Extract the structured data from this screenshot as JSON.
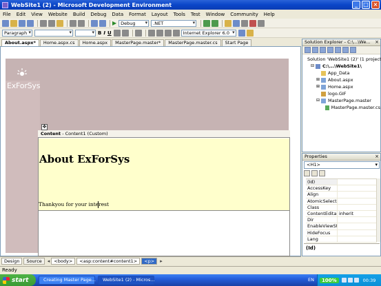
{
  "window": {
    "title": "WebSite1 (2) - Microsoft Development Environment"
  },
  "menu": [
    "File",
    "Edit",
    "View",
    "Website",
    "Build",
    "Debug",
    "Data",
    "Format",
    "Layout",
    "Tools",
    "Test",
    "Window",
    "Community",
    "Help"
  ],
  "toolbar1": {
    "config": "Debug",
    "platform": ".NET"
  },
  "toolbar2": {
    "block_format": "Paragraph",
    "browser_target": "Internet Explorer 6.0"
  },
  "doc_tabs": [
    {
      "label": "About.aspx*",
      "active": true
    },
    {
      "label": "Home.aspx.cs",
      "active": false
    },
    {
      "label": "Home.aspx",
      "active": false
    },
    {
      "label": "MasterPage.master*",
      "active": false
    },
    {
      "label": "MasterPage.master.cs",
      "active": false
    },
    {
      "label": "Start Page",
      "active": false
    }
  ],
  "designer": {
    "logo_text": "ExForSys",
    "content_label_bold": "Content",
    "content_label_rest": " - Content1 (Custom)",
    "heading": "About ExForSys",
    "body_text": "Thankyou for your interest"
  },
  "viewbar": {
    "design_label": "Design",
    "source_label": "Source",
    "tags": [
      "<body>",
      "<asp:content#content1>",
      "<p>"
    ]
  },
  "solution_explorer": {
    "title": "Solution Explorer - C:\\...\\We...",
    "items": [
      {
        "label": "Solution 'WebSite1 (2)' (1 project)",
        "indent": 0,
        "toggle": "",
        "icon_color": "#8a73c9"
      },
      {
        "label": "C:\\...\\WebSite1\\",
        "indent": 1,
        "toggle": "⊟",
        "icon_color": "#6d8cc9",
        "bold": true
      },
      {
        "label": "App_Data",
        "indent": 2,
        "toggle": "",
        "icon_color": "#e6c35a"
      },
      {
        "label": "About.aspx",
        "indent": 2,
        "toggle": "⊞",
        "icon_color": "#7fa4d8"
      },
      {
        "label": "Home.aspx",
        "indent": 2,
        "toggle": "⊞",
        "icon_color": "#7fa4d8"
      },
      {
        "label": "logo.GIF",
        "indent": 2,
        "toggle": "",
        "icon_color": "#d0a040"
      },
      {
        "label": "MasterPage.master",
        "indent": 2,
        "toggle": "⊟",
        "icon_color": "#7fa4d8"
      },
      {
        "label": "MasterPage.master.cs",
        "indent": 3,
        "toggle": "",
        "icon_color": "#5aaa5a"
      }
    ]
  },
  "properties": {
    "title": "Properties",
    "selected": "<H1>",
    "rows": [
      {
        "name": "(Id)",
        "value": ""
      },
      {
        "name": "AccessKey",
        "value": ""
      },
      {
        "name": "Align",
        "value": ""
      },
      {
        "name": "AtomicSelection",
        "value": ""
      },
      {
        "name": "Class",
        "value": ""
      },
      {
        "name": "ContentEditable",
        "value": "inherit"
      },
      {
        "name": "Dir",
        "value": ""
      },
      {
        "name": "EnableViewState",
        "value": ""
      },
      {
        "name": "HideFocus",
        "value": ""
      },
      {
        "name": "Lang",
        "value": ""
      }
    ],
    "description": "(Id)"
  },
  "status": "Ready",
  "taskbar": {
    "start": "start",
    "tasks": [
      {
        "label": "Creating Master Page...",
        "active": false
      },
      {
        "label": "WebSite1 (2) - Micros...",
        "active": true
      }
    ],
    "lang": "EN",
    "battery": "100%",
    "clock": "00:39"
  }
}
